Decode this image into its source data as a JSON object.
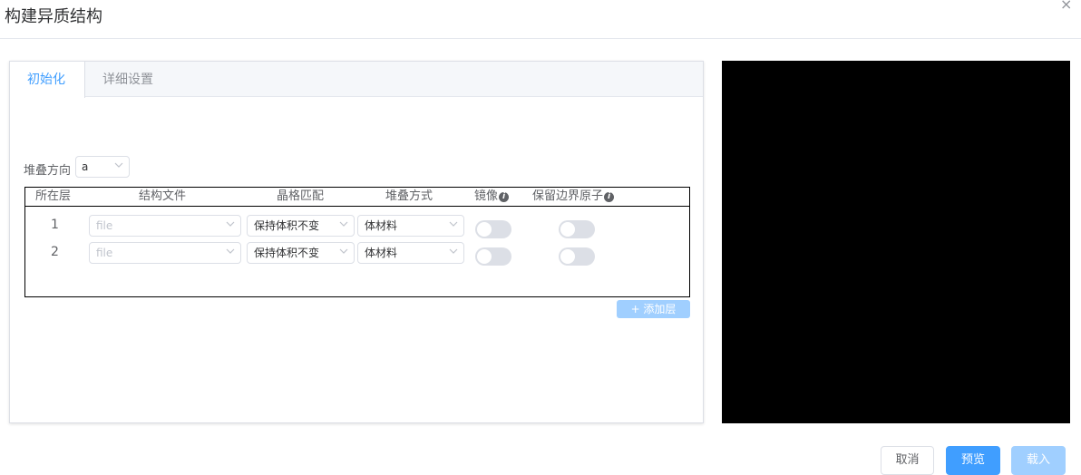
{
  "dialog": {
    "title": "构建异质结构",
    "close_label": "×"
  },
  "tabs": [
    {
      "label": "初始化",
      "active": true
    },
    {
      "label": "详细设置",
      "active": false
    }
  ],
  "init": {
    "stack_direction_label": "堆叠方向",
    "stack_direction_value": "a",
    "table": {
      "headers": [
        "所在层",
        "结构文件",
        "晶格匹配",
        "堆叠方式",
        "镜像",
        "保留边界原子"
      ],
      "info_icon": "i",
      "rows": [
        {
          "layer": "1",
          "file_placeholder": "file",
          "lattice_match": "保持体积不变",
          "stack_mode": "体材料",
          "mirror": false,
          "keep_boundary_atoms": false
        },
        {
          "layer": "2",
          "file_placeholder": "file",
          "lattice_match": "保持体积不变",
          "stack_mode": "体材料",
          "mirror": false,
          "keep_boundary_atoms": false
        }
      ]
    },
    "add_layer_label": "+ 添加层"
  },
  "footer": {
    "cancel_label": "取消",
    "preview_label": "预览",
    "load_label": "载入"
  },
  "colors": {
    "primary": "#409eff",
    "primary_disabled": "#a0cfff",
    "switch_off": "#dcdfe6"
  }
}
